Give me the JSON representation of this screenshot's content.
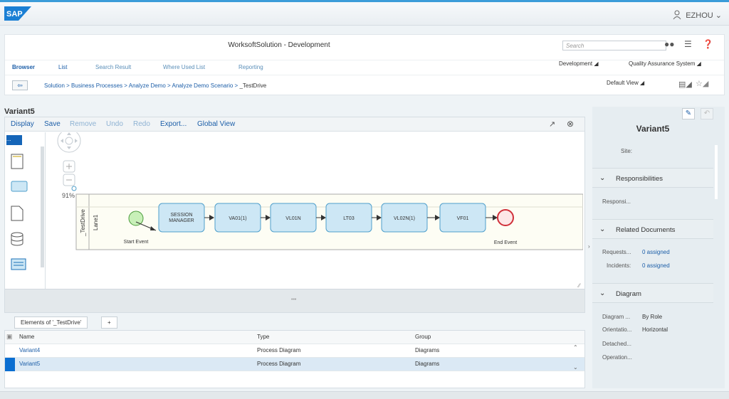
{
  "shell": {
    "logo": "SAP",
    "user": "EZHOU"
  },
  "app": {
    "title": "WorksoftSolution - Development",
    "search_placeholder": "Search",
    "tabs": [
      {
        "label": "Browser"
      },
      {
        "label": "List"
      },
      {
        "label": "Search Result"
      },
      {
        "label": "Where Used List"
      },
      {
        "label": "Reporting"
      }
    ],
    "menus": {
      "development": "Development",
      "qa": "Quality Assurance System"
    },
    "breadcrumb": [
      "Solution",
      "Business Processes",
      "Analyze Demo",
      "Analyze Demo Scenario"
    ],
    "breadcrumb_current": "_TestDrive",
    "default_view": "Default View"
  },
  "variant": {
    "title": "Variant5"
  },
  "toolbar": {
    "display": "Display",
    "save": "Save",
    "remove": "Remove",
    "undo": "Undo",
    "redo": "Redo",
    "export": "Export...",
    "global_view": "Global View"
  },
  "diagram": {
    "zoom": "91%",
    "pool": "_TestDrive",
    "lane": "Lane1",
    "start": "Start Event",
    "end": "End Event",
    "steps": [
      {
        "l1": "SESSION",
        "l2": "MANAGER"
      },
      {
        "l1": "VA01(1)"
      },
      {
        "l1": "VL01N"
      },
      {
        "l1": "LT03"
      },
      {
        "l1": "VL02N(1)"
      },
      {
        "l1": "VF01"
      }
    ]
  },
  "bottom": {
    "tab": "Elements of '_TestDrive'",
    "add": "+",
    "headers": {
      "name": "Name",
      "type": "Type",
      "group": "Group"
    },
    "rows": [
      {
        "name": "Variant4",
        "type": "Process Diagram",
        "group": "Diagrams"
      },
      {
        "name": "Variant5",
        "type": "Process Diagram",
        "group": "Diagrams"
      }
    ]
  },
  "panel": {
    "title": "Variant5",
    "site_label": "Site:",
    "responsibilities": "Responsibilities",
    "responsi": "Responsi...",
    "related_documents": "Related Documents",
    "requests_label": "Requests...",
    "requests_value": "0 assigned",
    "incidents_label": "Incidents:",
    "incidents_value": "0 assigned",
    "diagram": "Diagram",
    "diagram_label": "Diagram ...",
    "diagram_value": "By Role",
    "orientation_label": "Orientatio...",
    "orientation_value": "Horizontal",
    "detached": "Detached...",
    "operation": "Operation..."
  }
}
